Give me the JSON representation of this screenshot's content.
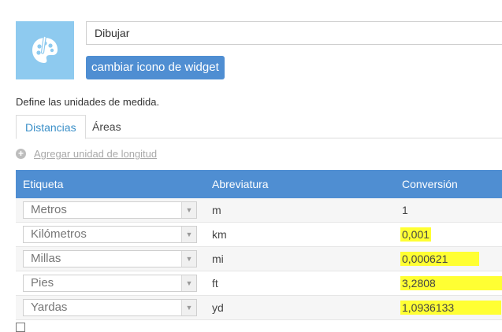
{
  "widget": {
    "icon": "palette-icon",
    "name_value": "Dibujar",
    "change_icon_label": "cambiar icono de widget"
  },
  "define_text": "Define las unidades de medida.",
  "tabs": [
    {
      "label": "Distancias",
      "active": true
    },
    {
      "label": "Áreas",
      "active": false
    }
  ],
  "add_unit_label": "Agregar unidad de longitud",
  "table": {
    "headers": {
      "label": "Etiqueta",
      "abbr": "Abreviatura",
      "conversion": "Conversión"
    },
    "rows": [
      {
        "label": "Metros",
        "abbr": "m",
        "conversion": "1",
        "highlighted": false
      },
      {
        "label": "Kilómetros",
        "abbr": "km",
        "conversion": "0,001",
        "highlighted": true
      },
      {
        "label": "Millas",
        "abbr": "mi",
        "conversion": "0,000621",
        "highlighted": true
      },
      {
        "label": "Pies",
        "abbr": "ft",
        "conversion": "3,2808",
        "highlighted": true
      },
      {
        "label": "Yardas",
        "abbr": "yd",
        "conversion": "1,0936133",
        "highlighted": true
      }
    ]
  },
  "colors": {
    "accent": "#4f8ed2",
    "icon_bg": "#8ecaef",
    "highlight": "#ffff33"
  }
}
